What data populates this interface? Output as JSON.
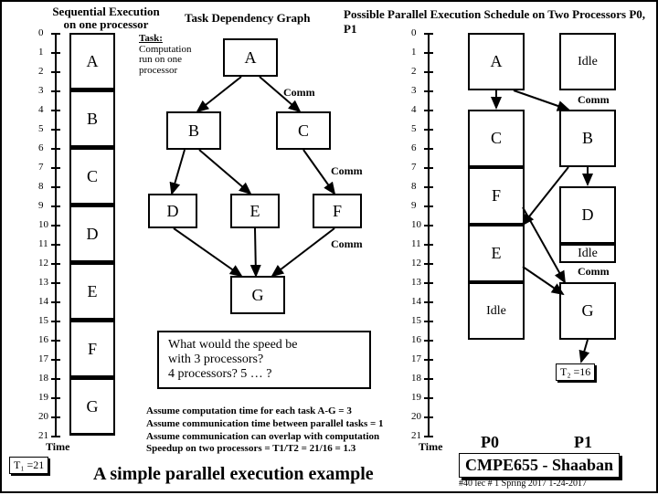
{
  "headers": {
    "seq": "Sequential Execution\non one processor",
    "dag": "Task Dependency Graph",
    "par": "Possible Parallel Execution Schedule on Two Processors P0, P1",
    "task_u": "Task:",
    "task_desc": "Computation\nrun on one\nprocessor"
  },
  "axis": {
    "time_label": "Time",
    "t1": "T₁ =21",
    "t2": "T₂ =16"
  },
  "seq": {
    "A": "A",
    "B": "B",
    "C": "C",
    "D": "D",
    "E": "E",
    "F": "F",
    "G": "G"
  },
  "dag": {
    "A": "A",
    "B": "B",
    "C": "C",
    "D": "D",
    "E": "E",
    "F": "F",
    "G": "G"
  },
  "par": {
    "p0": "P0",
    "p1": "P1",
    "A": "A",
    "B": "B",
    "C": "C",
    "D": "D",
    "E": "E",
    "F": "F",
    "G": "G",
    "idle": "Idle"
  },
  "comm": "Comm",
  "question": {
    "l1": "What would the speed be",
    "l2": "with 3 processors?",
    "l3": "4 processors?  5 … ?"
  },
  "assume": {
    "l1": "Assume computation time for each task A-G = 3",
    "l2": "Assume communication time between parallel tasks = 1",
    "l3": "Assume communication can overlap with computation",
    "l4": "Speedup on two processors = T1/T2 = 21/16 = 1.3"
  },
  "footer": {
    "title": "A simple parallel execution example",
    "course": "CMPE655 - Shaaban",
    "meta": "#40  lec # 1   Spring 2017   1-24-2017"
  },
  "chart_data": {
    "type": "table",
    "ticks": [
      0,
      1,
      2,
      3,
      4,
      5,
      6,
      7,
      8,
      9,
      10,
      11,
      12,
      13,
      14,
      15,
      16,
      17,
      18,
      19,
      20,
      21
    ],
    "computation_time": 3,
    "communication_time": 1,
    "sequential_T1": 21,
    "parallel_T2": 16,
    "speedup_2proc": 1.3,
    "dag_edges": [
      [
        "A",
        "B"
      ],
      [
        "A",
        "C"
      ],
      [
        "B",
        "D"
      ],
      [
        "B",
        "E"
      ],
      [
        "C",
        "F"
      ],
      [
        "D",
        "G"
      ],
      [
        "E",
        "G"
      ],
      [
        "F",
        "G"
      ]
    ],
    "sequential_order": [
      "A",
      "B",
      "C",
      "D",
      "E",
      "F",
      "G"
    ],
    "parallel_schedule": {
      "P0": [
        [
          "A",
          0,
          3
        ],
        [
          "C",
          4,
          7
        ],
        [
          "F",
          7,
          10
        ],
        [
          "E",
          10,
          13
        ],
        [
          "Idle",
          13,
          16
        ]
      ],
      "P1": [
        [
          "Idle",
          0,
          3
        ],
        [
          "B",
          4,
          7
        ],
        [
          "D",
          8,
          11
        ],
        [
          "Idle",
          11,
          12
        ],
        [
          "G",
          13,
          16
        ]
      ]
    }
  }
}
